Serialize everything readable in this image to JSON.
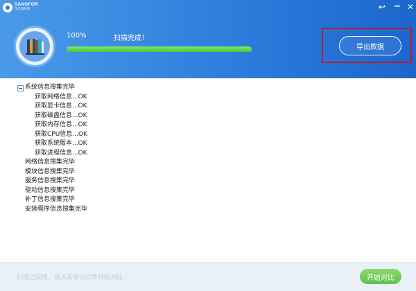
{
  "brand": {
    "name": "SANGFOR",
    "subtitle": "深信服科技"
  },
  "window_controls": {
    "restore_icon": "↩",
    "minimize_icon": "−",
    "close_icon": "✕"
  },
  "scan": {
    "percent_label": "100%",
    "progress_fraction": 1.0,
    "status": "扫描完成！"
  },
  "export_button_label": "导出数据",
  "colors": {
    "header_blue": "#2f7ddd",
    "progress_green": "#49c93b",
    "highlight_red": "#c0182c",
    "compare_green": "#5fc14b"
  },
  "tree": {
    "root_label": "系统信息搜集完毕",
    "children": [
      "获取网络信息...OK",
      "获取显卡信息...OK",
      "获取磁盘信息...OK",
      "获取内存信息...OK",
      "获取CPU信息...OK",
      "获取系统版本...OK",
      "获取进程信息...OK"
    ],
    "siblings": [
      "网络信息搜集完毕",
      "模块信息搜集完毕",
      "服务信息搜集完毕",
      "驱动信息搜集完毕",
      "补丁信息搜集完毕",
      "安装程序信息搜集完毕"
    ]
  },
  "footer": {
    "message": "扫描已完成，请点击导出文件开始对比...",
    "compare_button_label": "开始对比"
  }
}
